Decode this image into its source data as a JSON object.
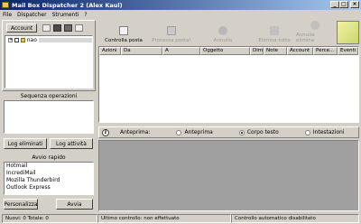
{
  "window": {
    "title": "Mail Box Dispatcher 2 (Alex Kaul)"
  },
  "menu": [
    "File",
    "Dispatcher",
    "Strumenti",
    "?"
  ],
  "left": {
    "account_button": "Account",
    "account_prefix": "nao",
    "operations_caption": "Sequenza operazioni",
    "log_eliminati": "Log eliminati",
    "log_attivita": "Log attività",
    "quick_caption": "Avvio rapido",
    "quick_items": [
      "Hotmail",
      "IncrediMail",
      "Mozilla Thunderbird",
      "Outlook Express"
    ],
    "personalizza": "Personalizza",
    "avvia": "Avvia"
  },
  "toolbar": {
    "controlla": "Controlla posta",
    "processa": "Processa posta!",
    "annulla": "Annulla",
    "elimina_tutto": "Elimina tutto",
    "annulla_elimina": "Annulla elimina"
  },
  "table": {
    "columns": [
      "Azioni",
      "Da",
      "A",
      "Oggetto",
      "Dim.",
      "Note",
      "Account",
      "Perce...",
      "Eventi"
    ]
  },
  "preview": {
    "label": "Anteprima:",
    "options": [
      "Anteprima",
      "Corpo testo",
      "Intestazioni"
    ],
    "selected": "Corpo testo"
  },
  "status": {
    "counts": "Nuovi: 0 Totale: 0",
    "last_check": "Ultimo controllo: non effettuato",
    "auto": "Controllo automatico disabilitato"
  },
  "colors": {
    "title_start": "#0a246a",
    "title_end": "#a6caf0",
    "face": "#d4d0c8",
    "preview_area": "#a0a0a0"
  }
}
